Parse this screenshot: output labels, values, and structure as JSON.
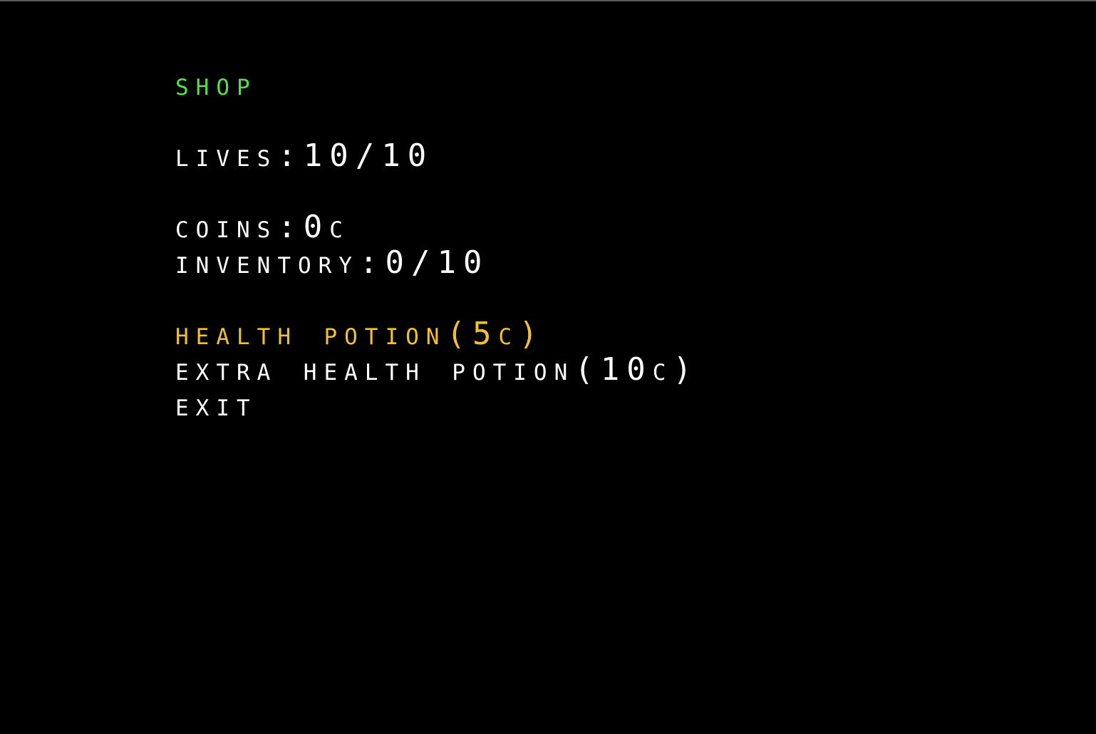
{
  "title": "Shop",
  "stats": {
    "lives": "Lives:10/10",
    "coins": "Coins:0c",
    "inventory": "Inventory:0/10"
  },
  "menu": [
    {
      "label": "Health Potion(5c)",
      "selected": true
    },
    {
      "label": "Extra Health Potion(10c)",
      "selected": false
    },
    {
      "label": "Exit",
      "selected": false
    }
  ],
  "colors": {
    "title": "#55e04a",
    "selected": "#f2c12e",
    "text": "#ffffff",
    "background": "#000000"
  }
}
